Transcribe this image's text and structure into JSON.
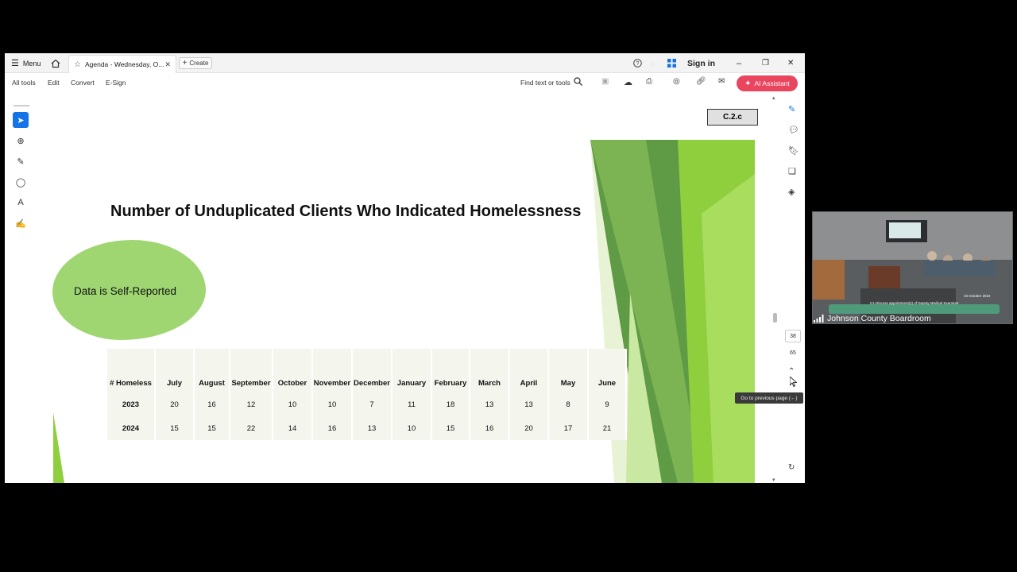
{
  "titlebar": {
    "menu_label": "Menu",
    "tab_label": "Agenda - Wednesday, O...",
    "create_label": "Create",
    "sign_in_label": "Sign in"
  },
  "toolbar": {
    "items": [
      "All tools",
      "Edit",
      "Convert",
      "E-Sign"
    ],
    "find_label": "Find text or tools",
    "ai_label": "AI Assistant"
  },
  "document": {
    "tag_label": "C.2.c",
    "title": "Number of Unduplicated Clients Who Indicated Homelessness",
    "callout": "Data is Self-Reported",
    "table": {
      "header": [
        "# Homeless",
        "July",
        "August",
        "September",
        "October",
        "November",
        "December",
        "January",
        "February",
        "March",
        "April",
        "May",
        "June"
      ],
      "rows": [
        [
          "2023",
          "20",
          "16",
          "12",
          "10",
          "10",
          "7",
          "11",
          "18",
          "13",
          "13",
          "8",
          "9"
        ],
        [
          "2024",
          "15",
          "15",
          "22",
          "14",
          "16",
          "13",
          "10",
          "15",
          "16",
          "20",
          "17",
          "21"
        ]
      ]
    }
  },
  "page_nav": {
    "current_page": "38",
    "total_pages": "65",
    "tooltip": "Go to previous page (←)"
  },
  "video": {
    "room_label": "Johnson County Boardroom",
    "screen_caption": "C1 Discuss appointment(s) of Deputy Medical Examiner",
    "date_caption": "23 October 2024"
  },
  "colors": {
    "accent_blue": "#1473e6",
    "ai_red": "#e9455e",
    "slide_green_light": "#9fd672",
    "slide_green_dark": "#5f9a44"
  }
}
